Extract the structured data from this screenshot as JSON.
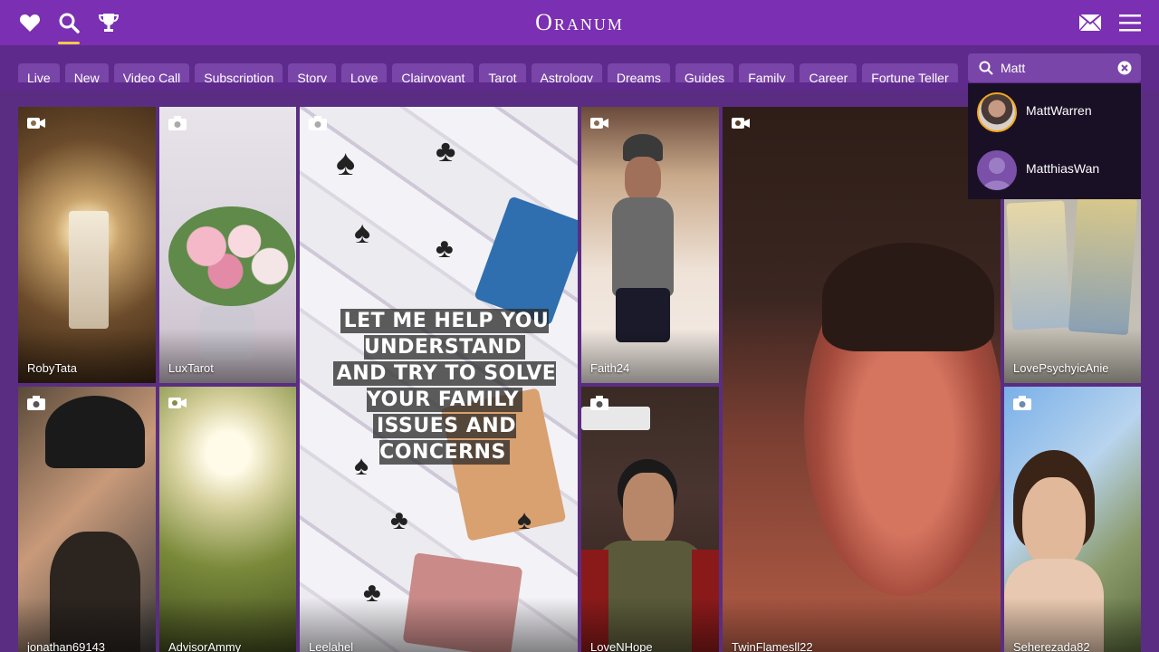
{
  "brand": {
    "logo": "Oranum"
  },
  "nav": {
    "icons": [
      "heart-icon",
      "search-icon",
      "trophy-icon",
      "mail-icon",
      "menu-icon"
    ],
    "active": "search"
  },
  "categories": [
    "Live",
    "New",
    "Video Call",
    "Subscription",
    "Story",
    "Love",
    "Clairvoyant",
    "Tarot",
    "Astrology",
    "Dreams",
    "Guides",
    "Family",
    "Career",
    "Fortune Teller"
  ],
  "search": {
    "value": "Matt",
    "results": [
      {
        "name": "MattWarren"
      },
      {
        "name": "MatthiasWan"
      }
    ]
  },
  "tiles": [
    {
      "name": "RobyTata",
      "media": "video-icon"
    },
    {
      "name": "LuxTarot",
      "media": "camera-icon"
    },
    {
      "name": "Leelahel",
      "media": "camera-icon",
      "overlay": [
        "LET ME HELP YOU UNDERSTAND",
        "AND TRY TO SOLVE YOUR FAMILY",
        "ISSUES AND CONCERNS"
      ]
    },
    {
      "name": "Faith24",
      "media": "video-icon"
    },
    {
      "name": "TwinFlamesll22",
      "media": "video-icon"
    },
    {
      "name": "LovePsychyicAnie",
      "media": "camera-icon"
    },
    {
      "name": "jonathan69143",
      "media": "camera-icon"
    },
    {
      "name": "AdvisorAmmy",
      "media": "video-icon"
    },
    {
      "name": "LoveNHope",
      "media": "camera-icon"
    },
    {
      "name": "Seherezada82",
      "media": "camera-icon"
    }
  ],
  "colors": {
    "topbar": "#7b2fb2",
    "background": "#5a2d82",
    "chip": "#7a45a8",
    "active": "#f2c94c"
  }
}
